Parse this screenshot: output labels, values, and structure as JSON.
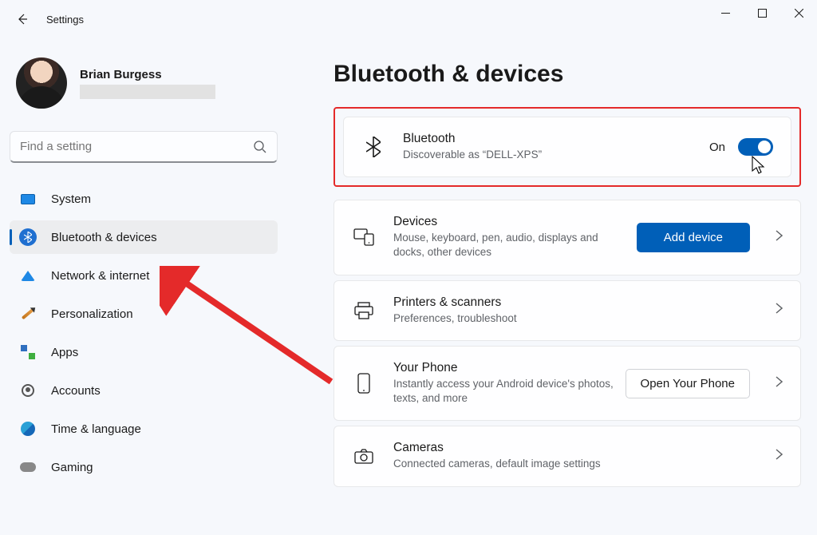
{
  "titlebar": {
    "title": "Settings"
  },
  "profile": {
    "name": "Brian Burgess"
  },
  "search": {
    "placeholder": "Find a setting"
  },
  "nav": {
    "items": [
      {
        "key": "system",
        "label": "System"
      },
      {
        "key": "bluetooth",
        "label": "Bluetooth & devices"
      },
      {
        "key": "network",
        "label": "Network & internet"
      },
      {
        "key": "personalization",
        "label": "Personalization"
      },
      {
        "key": "apps",
        "label": "Apps"
      },
      {
        "key": "accounts",
        "label": "Accounts"
      },
      {
        "key": "time",
        "label": "Time & language"
      },
      {
        "key": "gaming",
        "label": "Gaming"
      }
    ],
    "selectedKey": "bluetooth"
  },
  "page": {
    "title": "Bluetooth & devices",
    "bluetooth": {
      "title": "Bluetooth",
      "subtitle": "Discoverable as “DELL-XPS”",
      "state_label": "On",
      "state": true
    },
    "devices": {
      "title": "Devices",
      "subtitle": "Mouse, keyboard, pen, audio, displays and docks, other devices",
      "button": "Add device"
    },
    "printers": {
      "title": "Printers & scanners",
      "subtitle": "Preferences, troubleshoot"
    },
    "phone": {
      "title": "Your Phone",
      "subtitle": "Instantly access your Android device's photos, texts, and more",
      "button": "Open Your Phone"
    },
    "cameras": {
      "title": "Cameras",
      "subtitle": "Connected cameras, default image settings"
    }
  },
  "annotation": {
    "highlight_target": "bluetooth-card",
    "arrow_target": "sidebar-item-bluetooth"
  },
  "colors": {
    "accent": "#005fb8",
    "annotation": "#e42a2a"
  }
}
